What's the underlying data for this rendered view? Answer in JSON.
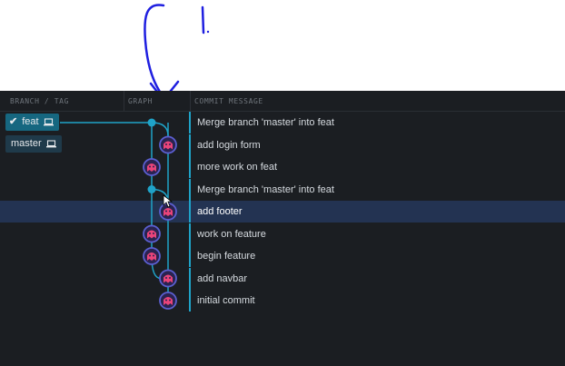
{
  "header": {
    "branch_tag": "BRANCH / TAG",
    "graph": "GRAPH",
    "commit_message": "COMMIT MESSAGE"
  },
  "branches": [
    {
      "name": "feat",
      "active": true,
      "icon": "laptop-icon"
    },
    {
      "name": "master",
      "active": false,
      "icon": "laptop-icon"
    }
  ],
  "commits": [
    {
      "message": "Merge branch 'master' into feat",
      "lane": "feat",
      "kind": "merge"
    },
    {
      "message": "add login form",
      "lane": "master",
      "kind": "avatar"
    },
    {
      "message": "more work on feat",
      "lane": "feat",
      "kind": "avatar"
    },
    {
      "message": "Merge branch 'master' into feat",
      "lane": "feat",
      "kind": "merge"
    },
    {
      "message": "add footer",
      "lane": "master",
      "kind": "avatar",
      "selected": true
    },
    {
      "message": "work on feature",
      "lane": "feat",
      "kind": "avatar"
    },
    {
      "message": "begin feature",
      "lane": "feat",
      "kind": "avatar"
    },
    {
      "message": "add navbar",
      "lane": "master",
      "kind": "avatar"
    },
    {
      "message": "initial commit",
      "lane": "master",
      "kind": "avatar"
    }
  ],
  "annotation": {
    "handwritten": "1."
  },
  "colors": {
    "lane": "#1fa3c8",
    "avatar": "#e9447a",
    "ring": "#5b5fd0",
    "selected_row": "#233352",
    "annotation_ink": "#1f1fe0"
  }
}
